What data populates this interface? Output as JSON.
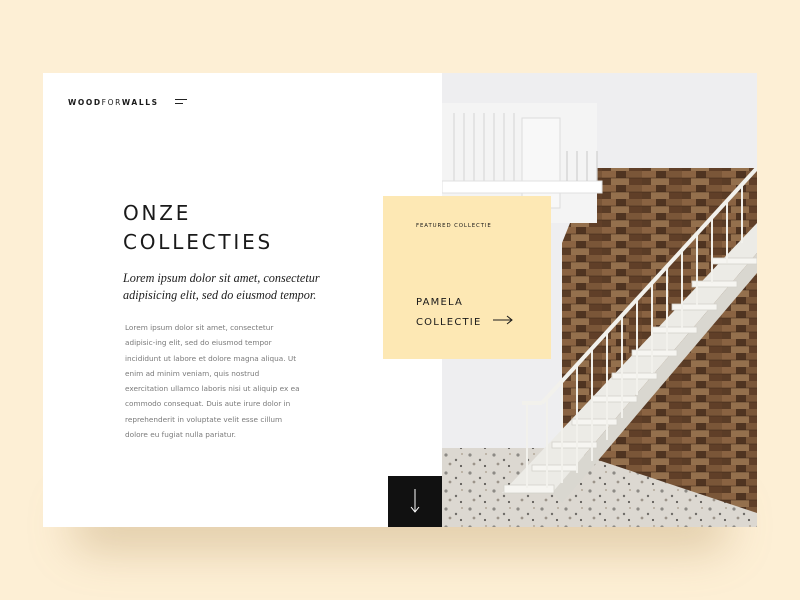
{
  "brand": {
    "logo_bold_1": "WOOD",
    "logo_thin": "FOR",
    "logo_bold_2": "WALLS"
  },
  "nav": {
    "menu_icon": "hamburger-menu-icon"
  },
  "hero": {
    "title_line1": "ONZE",
    "title_line2": "COLLECTIES",
    "subtitle": "Lorem ipsum dolor sit amet, consectetur adipisicing elit, sed do eiusmod tempor.",
    "body": "Lorem ipsum dolor sit amet, consectetur adipisic-ing elit, sed do eiusmod tempor incididunt ut labore et dolore magna aliqua. Ut enim ad minim veniam, quis nostrud exercitation ullamco laboris nisi ut aliquip ex ea commodo consequat. Duis aute irure dolor in reprehenderit in voluptate velit esse cillum dolore eu fugiat nulla pariatur."
  },
  "featured": {
    "label": "FEATURED COLLECTIE",
    "title_line1": "PAMELA",
    "title_line2": "COLLECTIE",
    "arrow_icon": "arrow-right-icon"
  },
  "scroll": {
    "icon": "arrow-down-icon"
  },
  "colors": {
    "page_background": "#fdefd5",
    "featured_background": "#fde8b4",
    "scroll_button": "#111111",
    "text_dark": "#1a1a1a",
    "text_muted": "#7a7a7a"
  }
}
